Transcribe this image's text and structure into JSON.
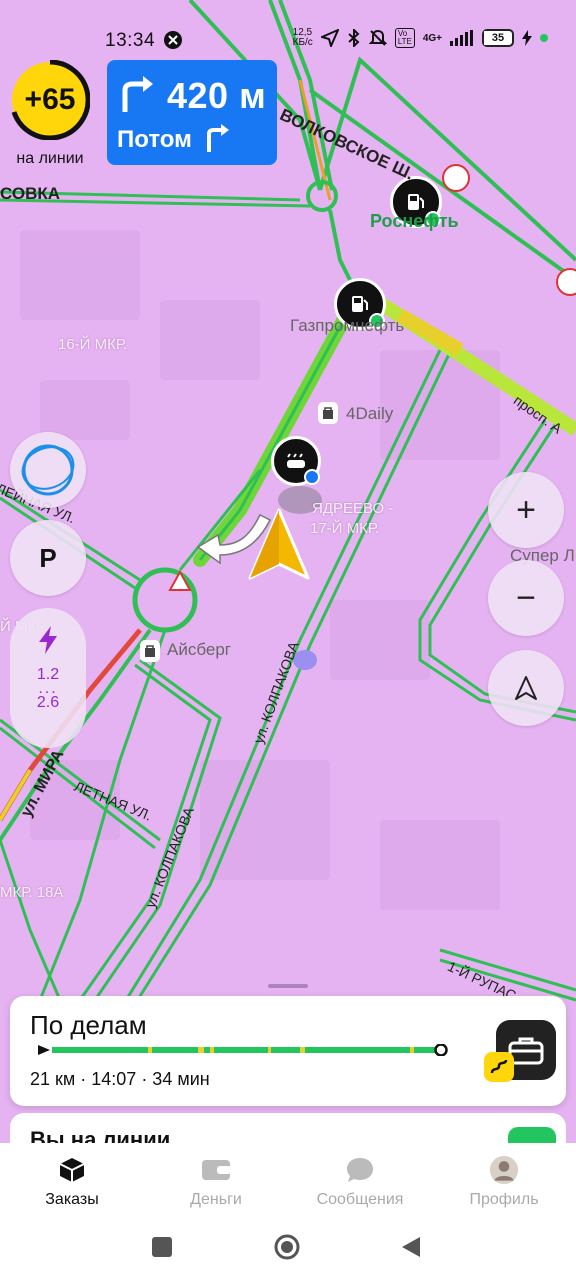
{
  "status_bar": {
    "time": "13:34",
    "net_speed_top": "12,5",
    "net_speed_bottom": "КБ/с",
    "volte": "Vo LTE",
    "network": "4G+",
    "battery": "35"
  },
  "driver": {
    "score": "+65",
    "status_label": "на линии"
  },
  "navigation": {
    "distance": "420 м",
    "then_label": "Потом",
    "turn_icon": "turn-right-icon"
  },
  "map_labels": {
    "volkovskoe": "ВОЛКОВСКОЕ Ш.",
    "sovka": "СОВКА",
    "rosneft": "Роснефть",
    "gazpromneft": "Газпромнефть",
    "mkr16": "16-Й МКР.",
    "daily": "4Daily",
    "prosp": "просп. А",
    "yadreevo": "ЯДРЕЕВО -",
    "mkr17": "17-Й МКР.",
    "super": "Супер Л",
    "leinaya": "ЛЕЙНАЯ УЛ.",
    "mkr_left": "Й МКР.",
    "aisberg": "Айсберг",
    "mira": "ул. МИРА",
    "letnaya": "ЛЕТНАЯ УЛ.",
    "kolpakova1": "ул. КОЛПАКОВА",
    "kolpakova2": "ул. КОЛПАКОВА",
    "mkr18a": "МКР. 18А",
    "rupas": "1-Й РУПАС"
  },
  "map_controls": {
    "zoom_in": "+",
    "zoom_out": "−",
    "parking": "P",
    "speed_top": "1.2",
    "speed_dots": "...",
    "speed_bottom": "2.6"
  },
  "trip": {
    "title": "По делам",
    "info": "21 км · 14:07 · 34 мин"
  },
  "online": {
    "text": "Вы на линии"
  },
  "bottom_nav": {
    "tabs": [
      {
        "label": "Заказы",
        "icon": "orders-box-icon",
        "active": true
      },
      {
        "label": "Деньги",
        "icon": "wallet-icon",
        "active": false
      },
      {
        "label": "Сообщения",
        "icon": "chat-bubble-icon",
        "active": false
      },
      {
        "label": "Профиль",
        "icon": "avatar-icon",
        "active": false
      }
    ]
  },
  "colors": {
    "map_bg": "#e6b3f2",
    "road_green": "#3cc85a",
    "road_yellow": "#e8d02c",
    "road_red": "#e04a3c",
    "nav_blue": "#1877f2",
    "score_yellow": "#ffd60a",
    "marker_yellow": "#f5b800"
  }
}
